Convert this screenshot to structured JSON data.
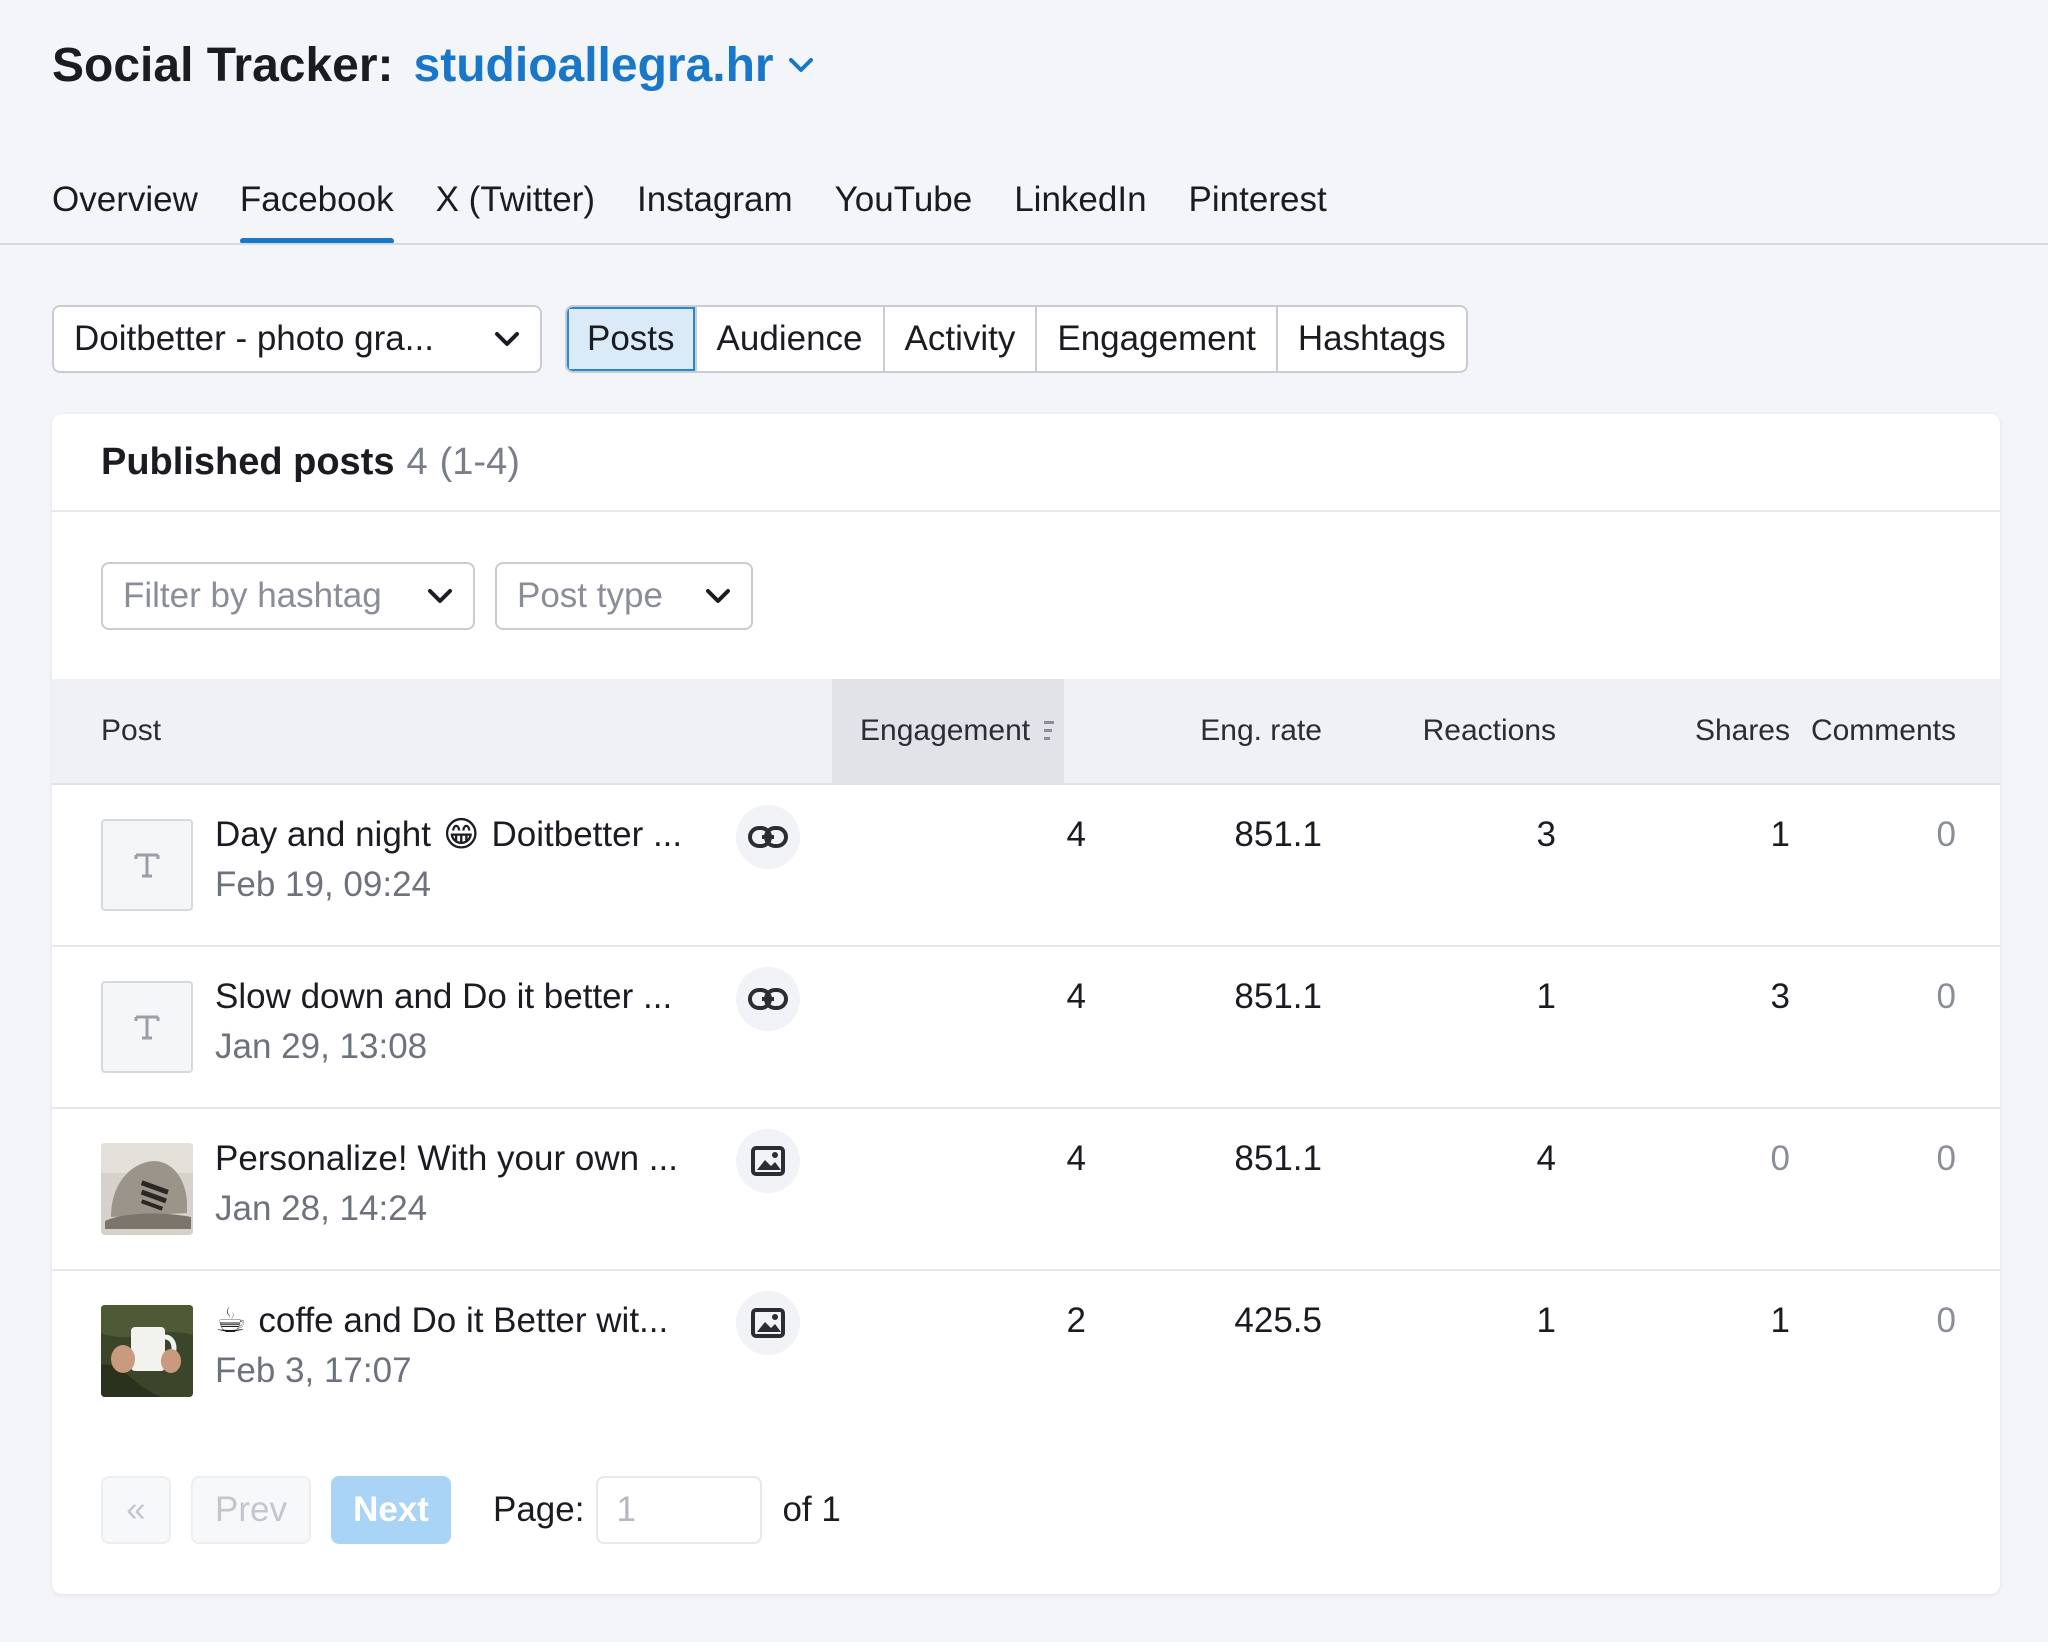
{
  "header": {
    "title": "Social Tracker:",
    "domain": "studioallegra.hr"
  },
  "tabs": [
    "Overview",
    "Facebook",
    "X (Twitter)",
    "Instagram",
    "YouTube",
    "LinkedIn",
    "Pinterest"
  ],
  "active_tab": "Facebook",
  "account_select": {
    "value": "Doitbetter - photo gra..."
  },
  "subtabs": [
    "Posts",
    "Audience",
    "Activity",
    "Engagement",
    "Hashtags"
  ],
  "active_subtab": "Posts",
  "card": {
    "title": "Published posts",
    "count": "4",
    "range": "(1-4)"
  },
  "filters": {
    "hashtag_placeholder": "Filter by hashtag",
    "post_type_placeholder": "Post type"
  },
  "table": {
    "columns": {
      "post": "Post",
      "engagement": "Engagement",
      "eng_rate": "Eng. rate",
      "reactions": "Reactions",
      "shares": "Shares",
      "comments": "Comments"
    },
    "sorted_column": "engagement",
    "rows": [
      {
        "thumb": "text-post-icon",
        "text_before": "Day and night",
        "emoji": "😁",
        "text_after": "Doitbetter ...",
        "date": "Feb 19, 09:24",
        "type_icon": "link-icon",
        "engagement": "4",
        "eng_rate": "851.1",
        "reactions": "3",
        "shares": "1",
        "comments": "0"
      },
      {
        "thumb": "text-post-icon",
        "text_before": "Slow down and Do it better ...",
        "emoji": "",
        "text_after": "",
        "date": "Jan 29, 13:08",
        "type_icon": "link-icon",
        "engagement": "4",
        "eng_rate": "851.1",
        "reactions": "1",
        "shares": "3",
        "comments": "0"
      },
      {
        "thumb": "photo-cap",
        "text_before": "Personalize! With your own ...",
        "emoji": "",
        "text_after": "",
        "date": "Jan 28, 14:24",
        "type_icon": "image-icon",
        "engagement": "4",
        "eng_rate": "851.1",
        "reactions": "4",
        "shares": "0",
        "comments": "0"
      },
      {
        "thumb": "photo-mug",
        "text_before": "",
        "emoji": "☕",
        "text_after": "coffe and Do it Better wit...",
        "date": "Feb 3, 17:07",
        "type_icon": "image-icon",
        "engagement": "2",
        "eng_rate": "425.5",
        "reactions": "1",
        "shares": "1",
        "comments": "0"
      }
    ]
  },
  "pagination": {
    "first_label": "«",
    "prev_label": "Prev",
    "next_label": "Next",
    "page_label": "Page:",
    "page_value": "1",
    "of_label": "of 1"
  },
  "colors": {
    "accent": "#1877c8",
    "background": "#f3f5f9",
    "next_button": "#a9d4f5"
  }
}
